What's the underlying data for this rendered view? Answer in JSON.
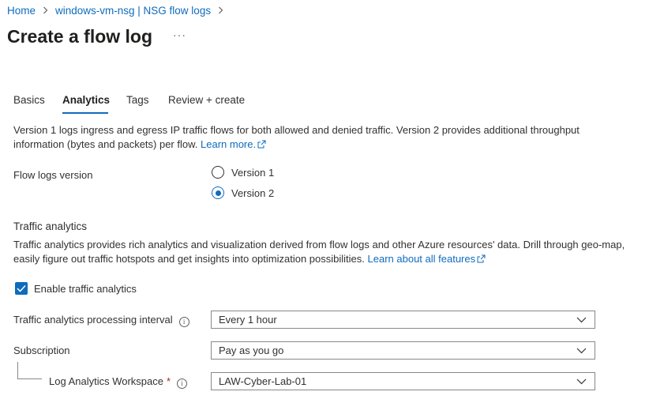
{
  "breadcrumb": {
    "items": [
      "Home",
      "windows-vm-nsg | NSG flow logs"
    ]
  },
  "page": {
    "title": "Create a flow log",
    "more_label": "···"
  },
  "tabs": [
    {
      "label": "Basics",
      "active": false
    },
    {
      "label": "Analytics",
      "active": true
    },
    {
      "label": "Tags",
      "active": false
    },
    {
      "label": "Review + create",
      "active": false
    }
  ],
  "intro": {
    "text": "Version 1 logs ingress and egress IP traffic flows for both allowed and denied traffic. Version 2 provides additional throughput information (bytes and packets) per flow.",
    "link": "Learn more."
  },
  "flow_logs_version": {
    "label": "Flow logs version",
    "options": [
      {
        "label": "Version 1",
        "checked": false
      },
      {
        "label": "Version 2",
        "checked": true
      }
    ]
  },
  "traffic_analytics": {
    "heading": "Traffic analytics",
    "text": "Traffic analytics provides rich analytics and visualization derived from flow logs and other Azure resources' data. Drill through geo-map, easily figure out traffic hotspots and get insights into optimization possibilities.",
    "link": "Learn about all features",
    "enable_label": "Enable traffic analytics",
    "enabled": true
  },
  "fields": {
    "interval": {
      "label": "Traffic analytics processing interval",
      "value": "Every 1 hour"
    },
    "subscription": {
      "label": "Subscription",
      "value": "Pay as you go"
    },
    "workspace": {
      "label": "Log Analytics Workspace",
      "required_mark": "*",
      "value": "LAW-Cyber-Lab-01"
    }
  },
  "icons": {
    "info": "info-icon",
    "external_link": "external-link-icon",
    "chevron": "chevron-down-icon",
    "checkmark": "checkmark-icon"
  },
  "colors": {
    "accent": "#0f6cbd",
    "required": "#a4262c",
    "text": "#323130"
  }
}
